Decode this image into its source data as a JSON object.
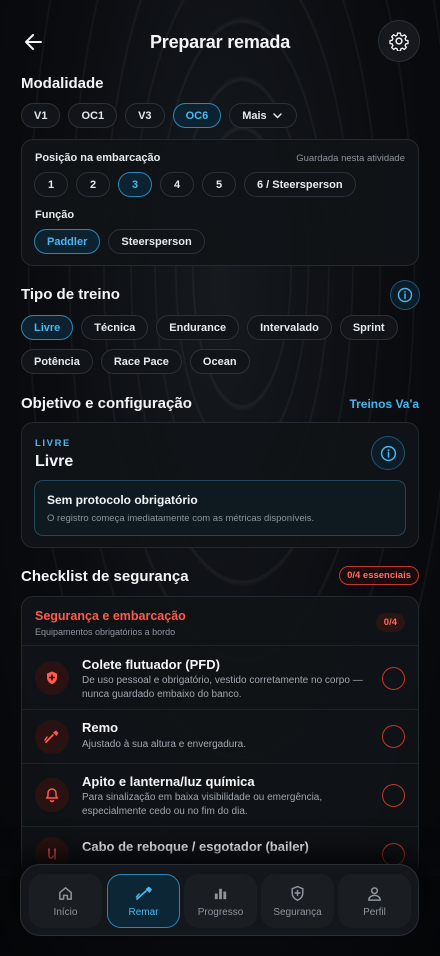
{
  "header": {
    "title": "Preparar remada"
  },
  "modalidade": {
    "title": "Modalidade",
    "chips": [
      "V1",
      "OC1",
      "V3",
      "OC6"
    ],
    "selected": "OC6",
    "more_label": "Mais"
  },
  "position": {
    "label": "Posição na embarcação",
    "hint": "Guardada nesta atividade",
    "options": [
      "1",
      "2",
      "3",
      "4",
      "5",
      "6 / Steersperson"
    ],
    "selected": "3"
  },
  "funcao": {
    "label": "Função",
    "options": [
      "Paddler",
      "Steersperson"
    ],
    "selected": "Paddler"
  },
  "tipo_treino": {
    "title": "Tipo de treino",
    "row1": [
      "Livre",
      "Técnica",
      "Endurance",
      "Intervalado",
      "Sprint"
    ],
    "row2": [
      "Potência",
      "Race Pace",
      "Ocean"
    ],
    "selected": "Livre"
  },
  "objetivo": {
    "title": "Objetivo e configuração",
    "link": "Treinos Va'a",
    "tag": "LIVRE",
    "name": "Livre",
    "protocol_title": "Sem protocolo obrigatório",
    "protocol_desc": "O registro começa imediatamente com as métricas disponíveis."
  },
  "checklist": {
    "title": "Checklist de segurança",
    "badge": "0/4 essenciais",
    "group_title": "Segurança e embarcação",
    "group_sub": "Equipamentos obrigatórios a bordo",
    "group_count": "0/4",
    "items": [
      {
        "title": "Colete flutuador (PFD)",
        "desc": "De uso pessoal e obrigatório, vestido corretamente no corpo — nunca guardado embaixo do banco."
      },
      {
        "title": "Remo",
        "desc": "Ajustado à sua altura e envergadura."
      },
      {
        "title": "Apito e lanterna/luz química",
        "desc": "Para sinalização em baixa visibilidade ou emergência, especialmente cedo ou no fim do dia."
      },
      {
        "title": "Cabo de reboque / esgotador (bailer)",
        "desc": ""
      }
    ]
  },
  "nav": {
    "items": [
      "Início",
      "Remar",
      "Progresso",
      "Segurança",
      "Perfil"
    ],
    "active": "Remar"
  },
  "colors": {
    "accent": "#49b7ee",
    "danger": "#ff5a4d",
    "bg": "#07090c"
  }
}
